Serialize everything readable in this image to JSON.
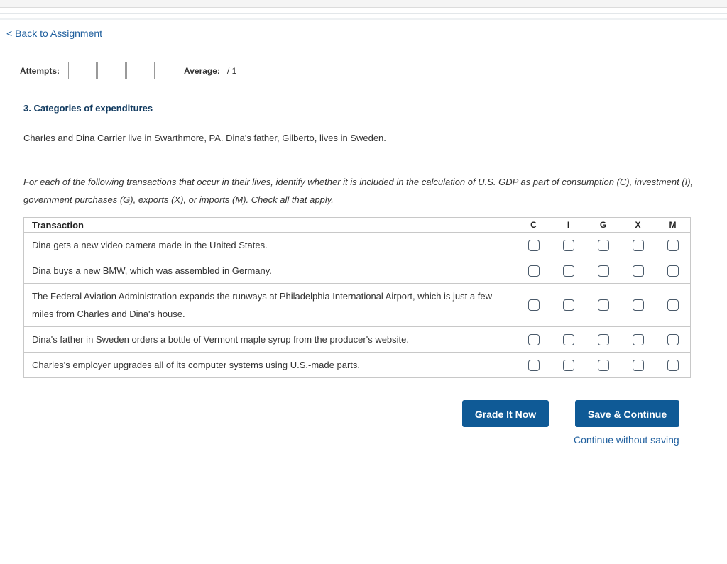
{
  "nav": {
    "back_label": "< Back to Assignment"
  },
  "attempts": {
    "label": "Attempts:",
    "boxes": [
      "",
      "",
      ""
    ]
  },
  "average": {
    "label": "Average:",
    "value": "/ 1"
  },
  "question": {
    "title": "3. Categories of expenditures",
    "intro": "Charles and Dina Carrier live in Swarthmore, PA. Dina's father, Gilberto, lives in Sweden.",
    "instructions": "For each of the following transactions that occur in their lives, identify whether it is included in the calculation of U.S. GDP as part of consumption (C), investment (I), government purchases (G), exports (X), or imports (M). Check all that apply."
  },
  "table": {
    "headers": {
      "transaction": "Transaction",
      "c": "C",
      "i": "I",
      "g": "G",
      "x": "X",
      "m": "M"
    },
    "rows": [
      {
        "text": "Dina gets a new video camera made in the United States.",
        "checked": [
          false,
          false,
          false,
          false,
          false
        ]
      },
      {
        "text": "Dina buys a new BMW, which was assembled in Germany.",
        "checked": [
          false,
          false,
          false,
          false,
          false
        ]
      },
      {
        "text": "The Federal Aviation Administration expands the runways at Philadelphia International Airport, which is just a few miles from Charles and Dina's house.",
        "checked": [
          false,
          false,
          false,
          false,
          false
        ]
      },
      {
        "text": "Dina's father in Sweden orders a bottle of Vermont maple syrup from the producer's website.",
        "checked": [
          false,
          false,
          false,
          false,
          false
        ]
      },
      {
        "text": "Charles's employer upgrades all of its computer systems using U.S.-made parts.",
        "checked": [
          false,
          false,
          false,
          false,
          false
        ]
      }
    ]
  },
  "actions": {
    "grade_label": "Grade It Now",
    "save_label": "Save & Continue",
    "continue_label": "Continue without saving"
  },
  "colors": {
    "primary_button": "#0f5a96",
    "link": "#1f5f9e",
    "title": "#123b60"
  }
}
